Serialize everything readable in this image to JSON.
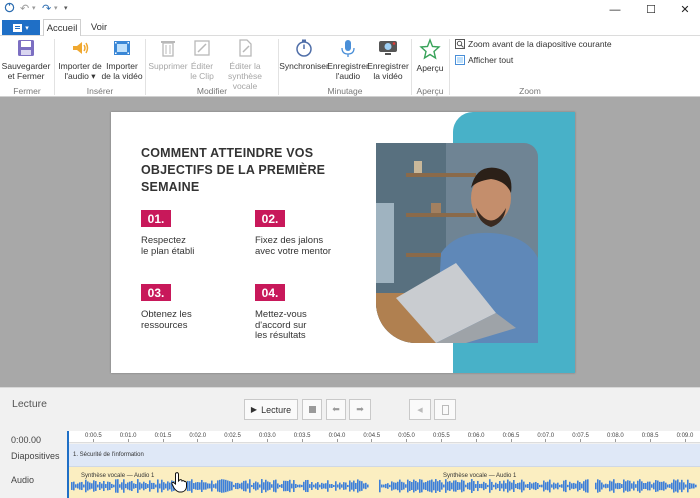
{
  "titlebar": {
    "quick_access": [
      "undo",
      "redo"
    ],
    "window": [
      "—",
      "☐",
      "✕"
    ]
  },
  "tabs": [
    {
      "label": "Accueil",
      "active": true
    },
    {
      "label": "Voir",
      "active": false
    }
  ],
  "ribbon": {
    "save_close": "Sauvegarder\net Fermer",
    "import_audio": "Importer de\nl'audio ▾",
    "import_video": "Importer\nde la vidéo",
    "delete": "Supprimer",
    "edit_clip": "Éditer\nle Clip",
    "edit_tts": "Éditer la\nsynthèse vocale",
    "sync": "Synchroniser",
    "record_audio": "Enregistrer\nl'audio",
    "record_video": "Enregistrer\nla vidéo",
    "preview": "Aperçu",
    "zoom_slide": "Zoom avant de la diapositive courante",
    "show_all": "Afficher tout",
    "groups": {
      "close": "Fermer",
      "insert": "Insérer",
      "modify": "Modifier",
      "timing": "Minutage",
      "preview": "Aperçu",
      "zoom": "Zoom"
    }
  },
  "slide": {
    "title": "COMMENT ATTEINDRE VOS OBJECTIFS DE LA PREMIÈRE SEMAINE",
    "objectives": [
      {
        "num": "01.",
        "text": "Respectez\nle plan établi"
      },
      {
        "num": "02.",
        "text": "Fixez des jalons\navec votre mentor"
      },
      {
        "num": "03.",
        "text": "Obtenez les\nressources"
      },
      {
        "num": "04.",
        "text": "Mettez-vous\nd'accord sur\nles résultats"
      }
    ],
    "accent": "#c8185a",
    "teal": "#48b1c8"
  },
  "lecture": {
    "label": "Lecture",
    "play": "Lecture"
  },
  "timeline": {
    "time": "0:00.00",
    "track_slides": "Diapositives",
    "track_audio": "Audio",
    "ticks": [
      "0:00.5",
      "0:01.0",
      "0:01.5",
      "0:02.0",
      "0:02.5",
      "0:03.0",
      "0:03.5",
      "0:04.0",
      "0:04.5",
      "0:05.0",
      "0:05.5",
      "0:06.0",
      "0:06.5",
      "0:07.0",
      "0:07.5",
      "0:08.0",
      "0:08.5",
      "0:09.0"
    ],
    "slide_clip": "1. Sécurité de l'information",
    "audio_clip1": "Synthèse vocale — Audio 1",
    "audio_clip2": "Synthèse vocale — Audio 1"
  }
}
